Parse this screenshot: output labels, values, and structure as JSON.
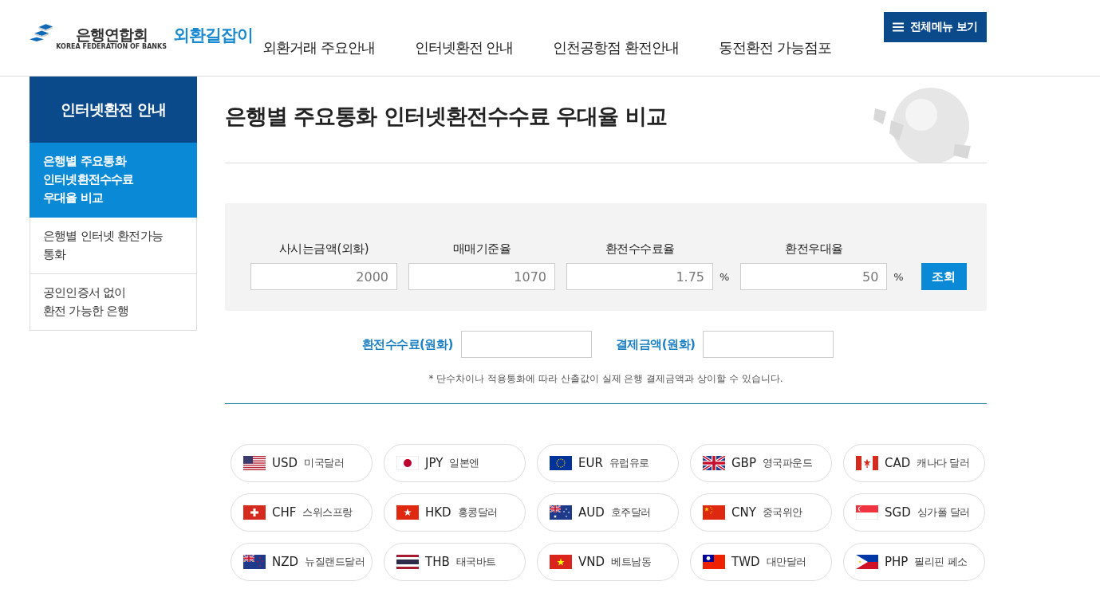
{
  "header": {
    "logo": {
      "name": "은행연합회",
      "subtitle": "KOREA FEDERATION OF BANKS",
      "service": "외환길잡이"
    },
    "nav": [
      {
        "label": "외환거래 주요안내"
      },
      {
        "label": "인터넷환전 안내"
      },
      {
        "label": "인천공항점 환전안내"
      },
      {
        "label": "동전환전 가능점포"
      }
    ],
    "menu_button": "전체메뉴 보기"
  },
  "sidebar": {
    "title": "인터넷환전 안내",
    "items": [
      {
        "label": "은행별 주요통화\n인터넷환전수수료\n우대율 비교",
        "selected": true
      },
      {
        "label": "은행별 인터넷 환전가능\n통화",
        "selected": false
      },
      {
        "label": "공인인증서 없이\n환전 가능한 은행",
        "selected": false
      }
    ]
  },
  "page_title": "은행별 주요통화 인터넷환전수수료 우대율 비교",
  "calculator": {
    "fields": [
      {
        "label": "사시는금액(외화)",
        "value": "2000"
      },
      {
        "label": "매매기준율",
        "value": "1070"
      },
      {
        "label": "환전수수료율",
        "value": "1.75",
        "unit": "%"
      },
      {
        "label": "환전우대율",
        "value": "50",
        "unit": "%"
      }
    ],
    "button": "조회",
    "results": [
      {
        "label": "환전수수료(원화)"
      },
      {
        "label": "결제금액(원화)"
      }
    ],
    "note": "* 단수차이나 적용통화에 따라 산출값이 실제 은행 결제금액과 상이할 수 있습니다."
  },
  "currencies": [
    {
      "code": "USD",
      "name": "미국달러",
      "kind": "us"
    },
    {
      "code": "JPY",
      "name": "일본엔",
      "kind": "jp"
    },
    {
      "code": "EUR",
      "name": "유럽유로",
      "kind": "eu"
    },
    {
      "code": "GBP",
      "name": "영국파운드",
      "kind": "gb"
    },
    {
      "code": "CAD",
      "name": "캐나다 달러",
      "kind": "ca"
    },
    {
      "code": "CHF",
      "name": "스위스프랑",
      "kind": "ch"
    },
    {
      "code": "HKD",
      "name": "홍콩달러",
      "kind": "hk"
    },
    {
      "code": "AUD",
      "name": "호주달러",
      "kind": "au"
    },
    {
      "code": "CNY",
      "name": "중국위안",
      "kind": "cn"
    },
    {
      "code": "SGD",
      "name": "싱가폴 달러",
      "kind": "sg"
    },
    {
      "code": "NZD",
      "name": "뉴질랜드달러",
      "kind": "nz"
    },
    {
      "code": "THB",
      "name": "태국바트",
      "kind": "th"
    },
    {
      "code": "VND",
      "name": "베트남동",
      "kind": "vn"
    },
    {
      "code": "TWD",
      "name": "대만달러",
      "kind": "tw"
    },
    {
      "code": "PHP",
      "name": "필리핀 페소",
      "kind": "ph"
    }
  ]
}
